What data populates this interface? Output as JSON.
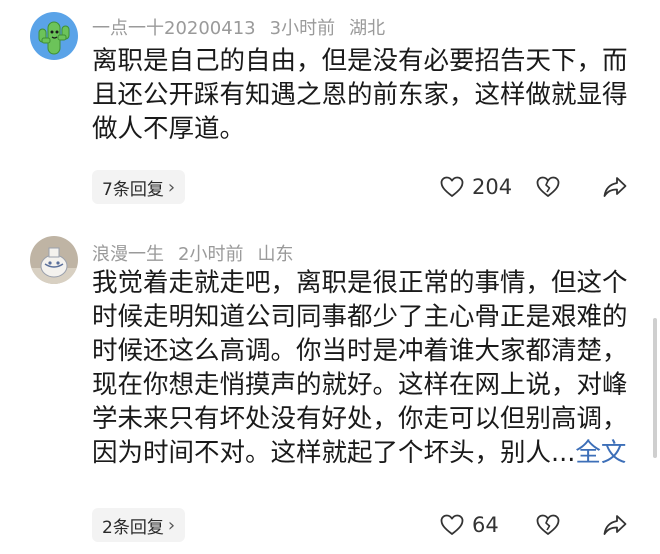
{
  "comments": [
    {
      "username": "一点一十20200413",
      "time": "3小时前",
      "location": "湖北",
      "text_lines": [
        "离职是自己的自由，但是没有必要招告天下，而",
        "且还公开踩有知遇之恩的前东家，这样做就显得",
        "做人不厚道。"
      ],
      "reply_label": "7条回复",
      "like_count": "204",
      "avatar_icon": "cactus-avatar-icon"
    },
    {
      "username": "浪漫一生",
      "time": "2小时前",
      "location": "山东",
      "text_lines": [
        "我觉着走就走吧，离职是很正常的事情，但这个",
        "时候走明知道公司同事都少了主心骨正是艰难的",
        "时候还这么高调。你当时是冲着谁大家都清楚，",
        "现在你想走悄摸声的就好。这样在网上说，对峰",
        "学未来只有坏处没有好处，你走可以但别高调，"
      ],
      "last_line": "因为时间不对。这样就起了个坏头，别人...",
      "full_text_label": "全文",
      "reply_label": "2条回复",
      "like_count": "64",
      "avatar_icon": "vase-avatar-icon"
    }
  ],
  "colors": {
    "meta_text": "#9a9a9a",
    "body_text": "#1a1a1a",
    "link": "#3d6fb8",
    "reply_bg": "#f3f3f3",
    "avatar1_bg": "#5aa3e8",
    "avatar1_cactus": "#6cc35a"
  },
  "icons": {
    "like": "heart-outline-icon",
    "dislike": "broken-heart-icon",
    "share": "share-arrow-icon",
    "chevron": "chevron-right-icon"
  }
}
